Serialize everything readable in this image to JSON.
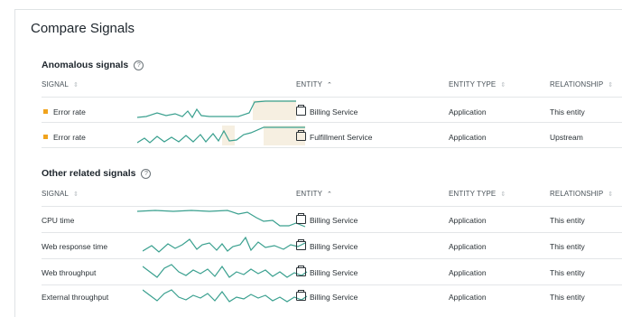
{
  "title": "Compare Signals",
  "help_glyph": "?",
  "columns": {
    "signal": "SIGNAL",
    "entity": "ENTITY",
    "entity_type": "ENTITY TYPE",
    "relationship": "RELATIONSHIP"
  },
  "sort_icons": {
    "inactive": "⇕",
    "active": "⌃"
  },
  "colors": {
    "anomaly": "#f0a31d",
    "sparkline": "#3aa08f",
    "highlight": "#f6efe1"
  },
  "anomalous": {
    "title": "Anomalous signals",
    "rows": [
      {
        "signal": "Error rate",
        "entity": "Billing Service",
        "entity_type": "Application",
        "relationship": "This entity"
      },
      {
        "signal": "Error rate",
        "entity": "Fulfillment Service",
        "entity_type": "Application",
        "relationship": "Upstream"
      }
    ]
  },
  "related": {
    "title": "Other related signals",
    "rows": [
      {
        "signal": "CPU time",
        "entity": "Billing Service",
        "entity_type": "Application",
        "relationship": "This entity"
      },
      {
        "signal": "Web response time",
        "entity": "Billing Service",
        "entity_type": "Application",
        "relationship": "This entity"
      },
      {
        "signal": "Web throughput",
        "entity": "Billing Service",
        "entity_type": "Application",
        "relationship": "This entity"
      },
      {
        "signal": "External throughput",
        "entity": "Billing Service",
        "entity_type": "Application",
        "relationship": "This entity"
      }
    ]
  }
}
